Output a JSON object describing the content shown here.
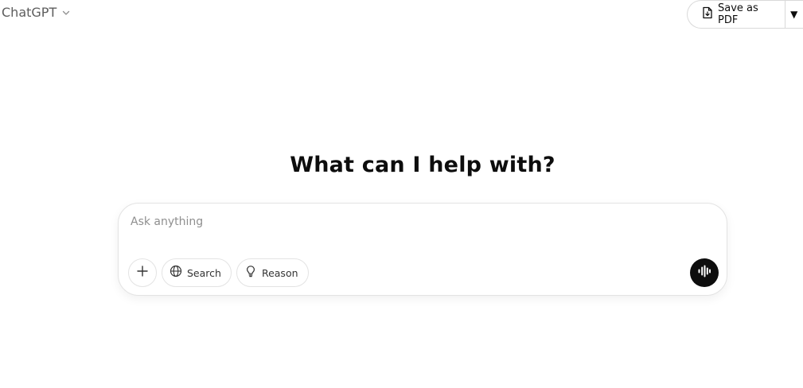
{
  "header": {
    "model_name": "ChatGPT",
    "model_icon": "chevron-down-icon"
  },
  "toolbar": {
    "save_pdf_label": "Save as PDF",
    "save_pdf_icon": "file-download-icon",
    "caret_symbol": "▼"
  },
  "main": {
    "heading": "What can I help with?"
  },
  "composer": {
    "placeholder": "Ask anything",
    "value": "",
    "tools": [
      {
        "icon": "plus-icon",
        "label": ""
      },
      {
        "icon": "globe-icon",
        "label": "Search"
      },
      {
        "icon": "lightbulb-icon",
        "label": "Reason"
      }
    ],
    "voice_icon": "voice-mode-icon"
  },
  "colors": {
    "background": "#ffffff",
    "text": "#0d0d0d",
    "muted": "#5d5d5d",
    "placeholder": "#8f8f8f",
    "border": "#e3e3e3",
    "voice_button": "#0d0d0d"
  }
}
